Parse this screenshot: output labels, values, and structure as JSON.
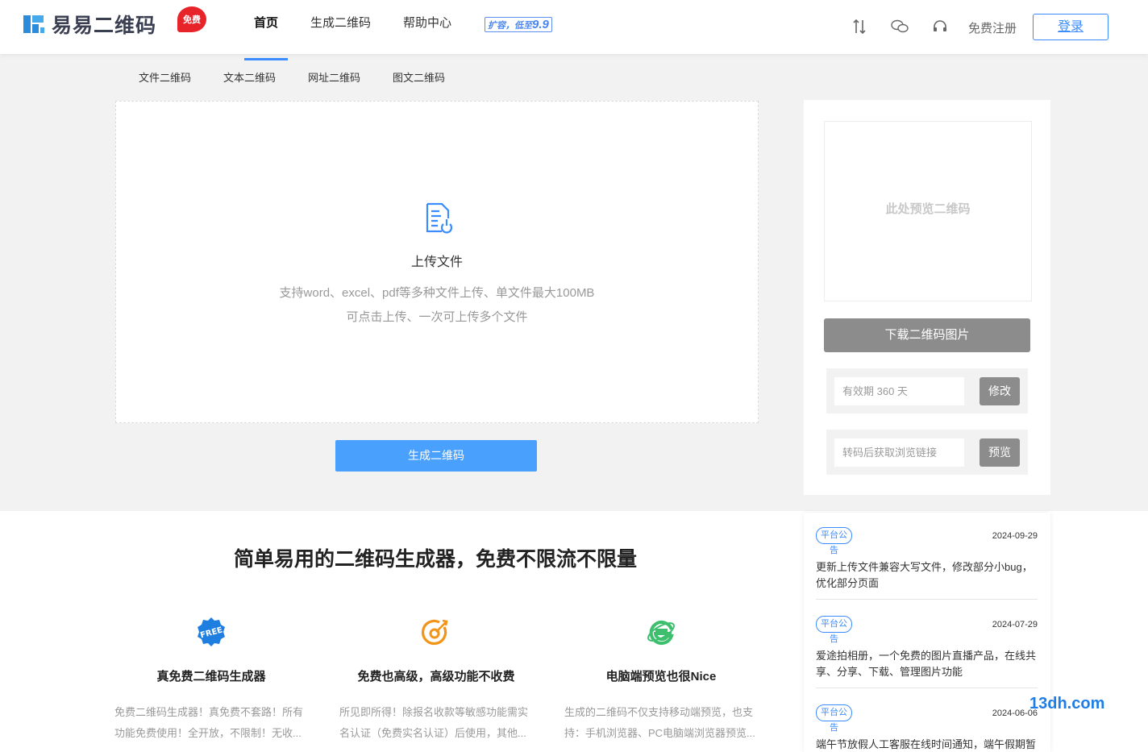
{
  "header": {
    "logo_text": "易易二维码",
    "logo_badge": "免费",
    "nav": [
      "首页",
      "生成二维码",
      "帮助中心"
    ],
    "promo_text": "扩容，低至",
    "promo_price": "9.9",
    "register": "免费注册",
    "login": "登录"
  },
  "subtabs": [
    "文件二维码",
    "文本二维码",
    "网址二维码",
    "图文二维码"
  ],
  "upload": {
    "title": "上传文件",
    "hint1": "支持word、excel、pdf等多种文件上传、单文件最大100MB",
    "hint2": "可点击上传、一次可上传多个文件",
    "generate_button": "生成二维码"
  },
  "preview": {
    "placeholder": "此处预览二维码",
    "download_button": "下载二维码图片",
    "validity_placeholder": "有效期 360 天",
    "modify_button": "修改",
    "link_placeholder": "转码后获取浏览链接",
    "preview_button": "预览"
  },
  "lower": {
    "slogan": "简单易用的二维码生成器，免费不限流不限量",
    "features": [
      {
        "icon": "free-badge-icon",
        "title": "真免费二维码生成器",
        "desc": "免费二维码生成器！真免费不套路！所有功能免费使用！全开放，不限制！无收..."
      },
      {
        "icon": "target-icon",
        "title": "免费也高级，高级功能不收费",
        "desc": "所见即所得！除报名收款等敏感功能需实名认证（免费实名认证）后使用，其他..."
      },
      {
        "icon": "ie-browser-icon",
        "title": "电脑端预览也很Nice",
        "desc": "生成的二维码不仅支持移动端预览，也支持：手机浏览器、PC电脑端浏览器预览..."
      }
    ]
  },
  "announcements": [
    {
      "tag": "平台公告",
      "date": "2024-09-29",
      "text": "更新上传文件兼容大写文件，修改部分小bug，优化部分页面"
    },
    {
      "tag": "平台公告",
      "date": "2024-07-29",
      "text": "爱途拍相册，一个免费的图片直播产品，在线共享、分享、下载、管理图片功能"
    },
    {
      "tag": "平台公告",
      "date": "2024-06-06",
      "text": "端午节放假人工客服在线时间通知，端午假期暂"
    }
  ],
  "watermark": "13dh.com",
  "colors": {
    "primary": "#4aa0fd",
    "accent": "#3b8cff",
    "badge": "#e8242b",
    "disabled": "#8c8c8c"
  }
}
